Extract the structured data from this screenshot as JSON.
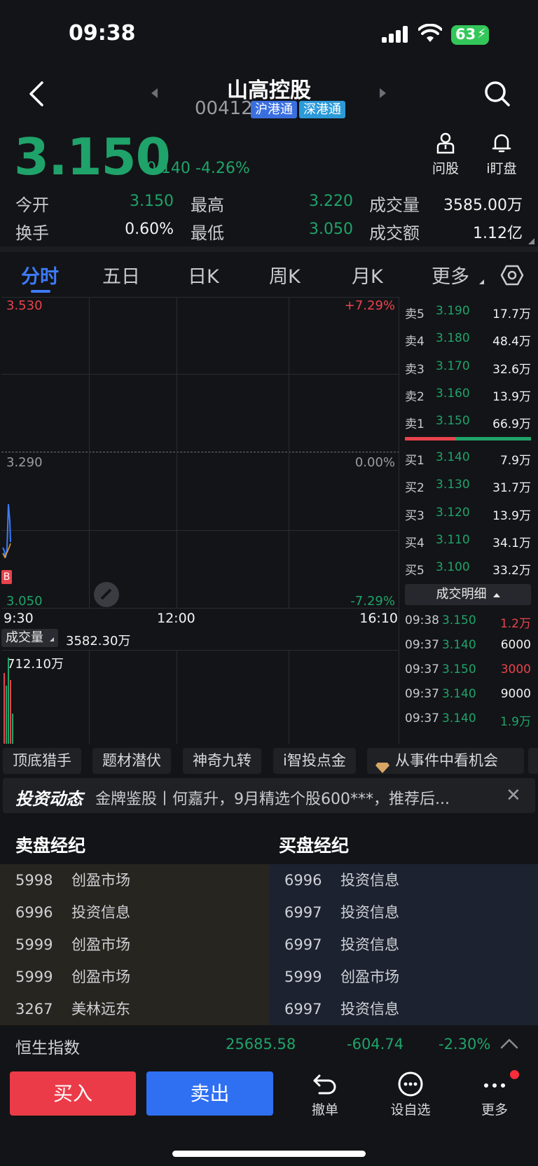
{
  "status_bar": {
    "time": "09:38",
    "battery": "63"
  },
  "header": {
    "stock_name": "山高控股",
    "stock_code": "00412",
    "tags": [
      "沪港通",
      "深港通"
    ],
    "actions": [
      {
        "label": "问股",
        "icon": "person-icon"
      },
      {
        "label": "i盯盘",
        "icon": "bell-icon"
      }
    ]
  },
  "quote": {
    "price": "3.150",
    "change": "-0.140",
    "change_pct": "-4.26%",
    "stats": [
      {
        "label": "今开",
        "value": "3.150",
        "color": "#1fa36a"
      },
      {
        "label": "最高",
        "value": "3.220",
        "color": "#1fa36a"
      },
      {
        "label": "成交量",
        "value": "3585.00万",
        "color": "#f2f2f2"
      },
      {
        "label": "换手",
        "value": "0.60%",
        "color": "#f2f2f2"
      },
      {
        "label": "最低",
        "value": "3.050",
        "color": "#1fa36a"
      },
      {
        "label": "成交额",
        "value": "1.12亿",
        "color": "#f2f2f2"
      }
    ]
  },
  "tabs": [
    "分时",
    "五日",
    "日K",
    "周K",
    "月K",
    "更多"
  ],
  "active_tab": "分时",
  "chart": {
    "y_top": "3.530",
    "y_mid": "3.290",
    "y_bottom": "3.050",
    "pct_top": "+7.29%",
    "pct_mid": "0.00%",
    "pct_bottom": "-7.29%",
    "x_labels": [
      "9:30",
      "12:00",
      "16:10"
    ],
    "buy_marker": "B",
    "volume_label": "成交量",
    "volume_total": "3582.30万",
    "volume_max": "712.10万"
  },
  "order_book": {
    "asks": [
      {
        "label": "卖5",
        "price": "3.190",
        "volume": "17.7万"
      },
      {
        "label": "卖4",
        "price": "3.180",
        "volume": "48.4万"
      },
      {
        "label": "卖3",
        "price": "3.170",
        "volume": "32.6万"
      },
      {
        "label": "卖2",
        "price": "3.160",
        "volume": "13.9万"
      },
      {
        "label": "卖1",
        "price": "3.150",
        "volume": "66.9万"
      }
    ],
    "bids": [
      {
        "label": "买1",
        "price": "3.140",
        "volume": "7.9万"
      },
      {
        "label": "买2",
        "price": "3.130",
        "volume": "31.7万"
      },
      {
        "label": "买3",
        "price": "3.120",
        "volume": "13.9万"
      },
      {
        "label": "买4",
        "price": "3.110",
        "volume": "34.1万"
      },
      {
        "label": "买5",
        "price": "3.100",
        "volume": "33.2万"
      }
    ],
    "details_label": "成交明细",
    "trades": [
      {
        "time": "09:38",
        "price": "3.150",
        "volume": "1.2万",
        "price_color": "#1fa36a",
        "vol_color": "#e8434c"
      },
      {
        "time": "09:37",
        "price": "3.140",
        "volume": "6000",
        "price_color": "#1fa36a",
        "vol_color": "#f2f2f2"
      },
      {
        "time": "09:37",
        "price": "3.150",
        "volume": "3000",
        "price_color": "#1fa36a",
        "vol_color": "#e8434c"
      },
      {
        "time": "09:37",
        "price": "3.140",
        "volume": "9000",
        "price_color": "#1fa36a",
        "vol_color": "#f2f2f2"
      },
      {
        "time": "09:37",
        "price": "3.140",
        "volume": "1.9万",
        "price_color": "#1fa36a",
        "vol_color": "#1fa36a"
      }
    ]
  },
  "feature_chips": [
    "顶底猎手",
    "题材潜伏",
    "神奇九转",
    "i智投点金",
    "从事件中看机会"
  ],
  "news": {
    "badge": "投资动态",
    "text": "金牌鉴股丨何嘉升，9月精选个股600***，推荐后..."
  },
  "brokers": {
    "sell_title": "卖盘经纪",
    "buy_title": "买盘经纪",
    "sell": [
      {
        "id": "5998",
        "name": "创盈市场"
      },
      {
        "id": "6996",
        "name": "投资信息"
      },
      {
        "id": "5999",
        "name": "创盈市场"
      },
      {
        "id": "5999",
        "name": "创盈市场"
      },
      {
        "id": "3267",
        "name": "美林远东"
      }
    ],
    "buy": [
      {
        "id": "6996",
        "name": "投资信息"
      },
      {
        "id": "6997",
        "name": "投资信息"
      },
      {
        "id": "6997",
        "name": "投资信息"
      },
      {
        "id": "5999",
        "name": "创盈市场"
      },
      {
        "id": "6997",
        "name": "投资信息"
      }
    ]
  },
  "index_bar": {
    "name": "恒生指数",
    "value": "25685.58",
    "change": "-604.74",
    "pct": "-2.30%"
  },
  "bottom_bar": {
    "buy_label": "买入",
    "sell_label": "卖出",
    "tools": [
      {
        "label": "撤单",
        "icon": "undo-icon"
      },
      {
        "label": "设自选",
        "icon": "more-circle-icon"
      },
      {
        "label": "更多",
        "icon": "dots-icon"
      }
    ]
  },
  "colors": {
    "up": "#e8434c",
    "down": "#1fa36a",
    "accent": "#3d7bf7"
  }
}
